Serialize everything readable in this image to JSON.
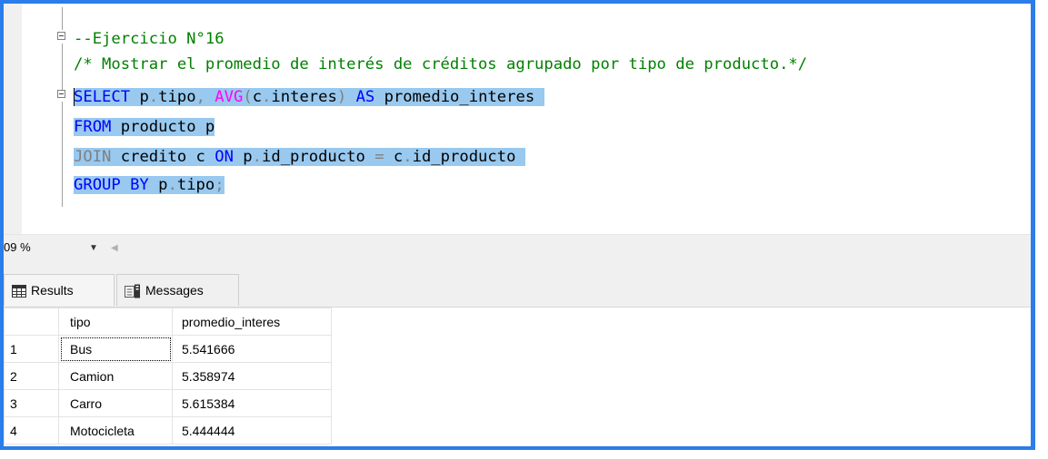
{
  "editor": {
    "lines": [
      {
        "comment": "--Ejercicio N°16"
      },
      {
        "comment": "/* Mostrar el promedio de interés de créditos agrupado por tipo de producto.*/"
      },
      {
        "t1": "SELECT",
        "t2": " p",
        "t3": ".",
        "t4": "tipo",
        "t5": ",",
        "t6": " ",
        "t7": "AVG",
        "t8": "(",
        "t9": "c",
        "t10": ".",
        "t11": "interes",
        "t12": ")",
        "t13": " ",
        "t14": "AS",
        "t15": " promedio_interes "
      },
      {
        "t1": "FROM",
        "t2": " producto p"
      },
      {
        "t1": "JOIN",
        "t2": " credito c ",
        "t3": "ON",
        "t4": " p",
        "t5": ".",
        "t6": "id_producto ",
        "t7": "=",
        "t8": " c",
        "t9": ".",
        "t10": "id_producto "
      },
      {
        "t1": "GROUP BY",
        "t2": " p",
        "t3": ".",
        "t4": "tipo",
        "t5": ";"
      }
    ]
  },
  "zoom": {
    "value": "09 %",
    "dropdown_icon": "chevron-down-icon",
    "scroll_icon": "scroll-left-icon"
  },
  "tabs": [
    {
      "label": "Results",
      "icon": "grid-icon"
    },
    {
      "label": "Messages",
      "icon": "messages-icon"
    }
  ],
  "results": {
    "columns": [
      "tipo",
      "promedio_interes"
    ],
    "rows": [
      {
        "n": "1",
        "tipo": "Bus",
        "promedio_interes": "5.541666"
      },
      {
        "n": "2",
        "tipo": "Camion",
        "promedio_interes": "5.358974"
      },
      {
        "n": "3",
        "tipo": "Carro",
        "promedio_interes": "5.615384"
      },
      {
        "n": "4",
        "tipo": "Motocicleta",
        "promedio_interes": "5.444444"
      }
    ]
  },
  "colors": {
    "frame_border": "#2b7de9",
    "selection": "#99c9ef",
    "keyword": "#0000ff",
    "comment": "#008000",
    "function": "#ff00ff",
    "operator": "#808080"
  }
}
